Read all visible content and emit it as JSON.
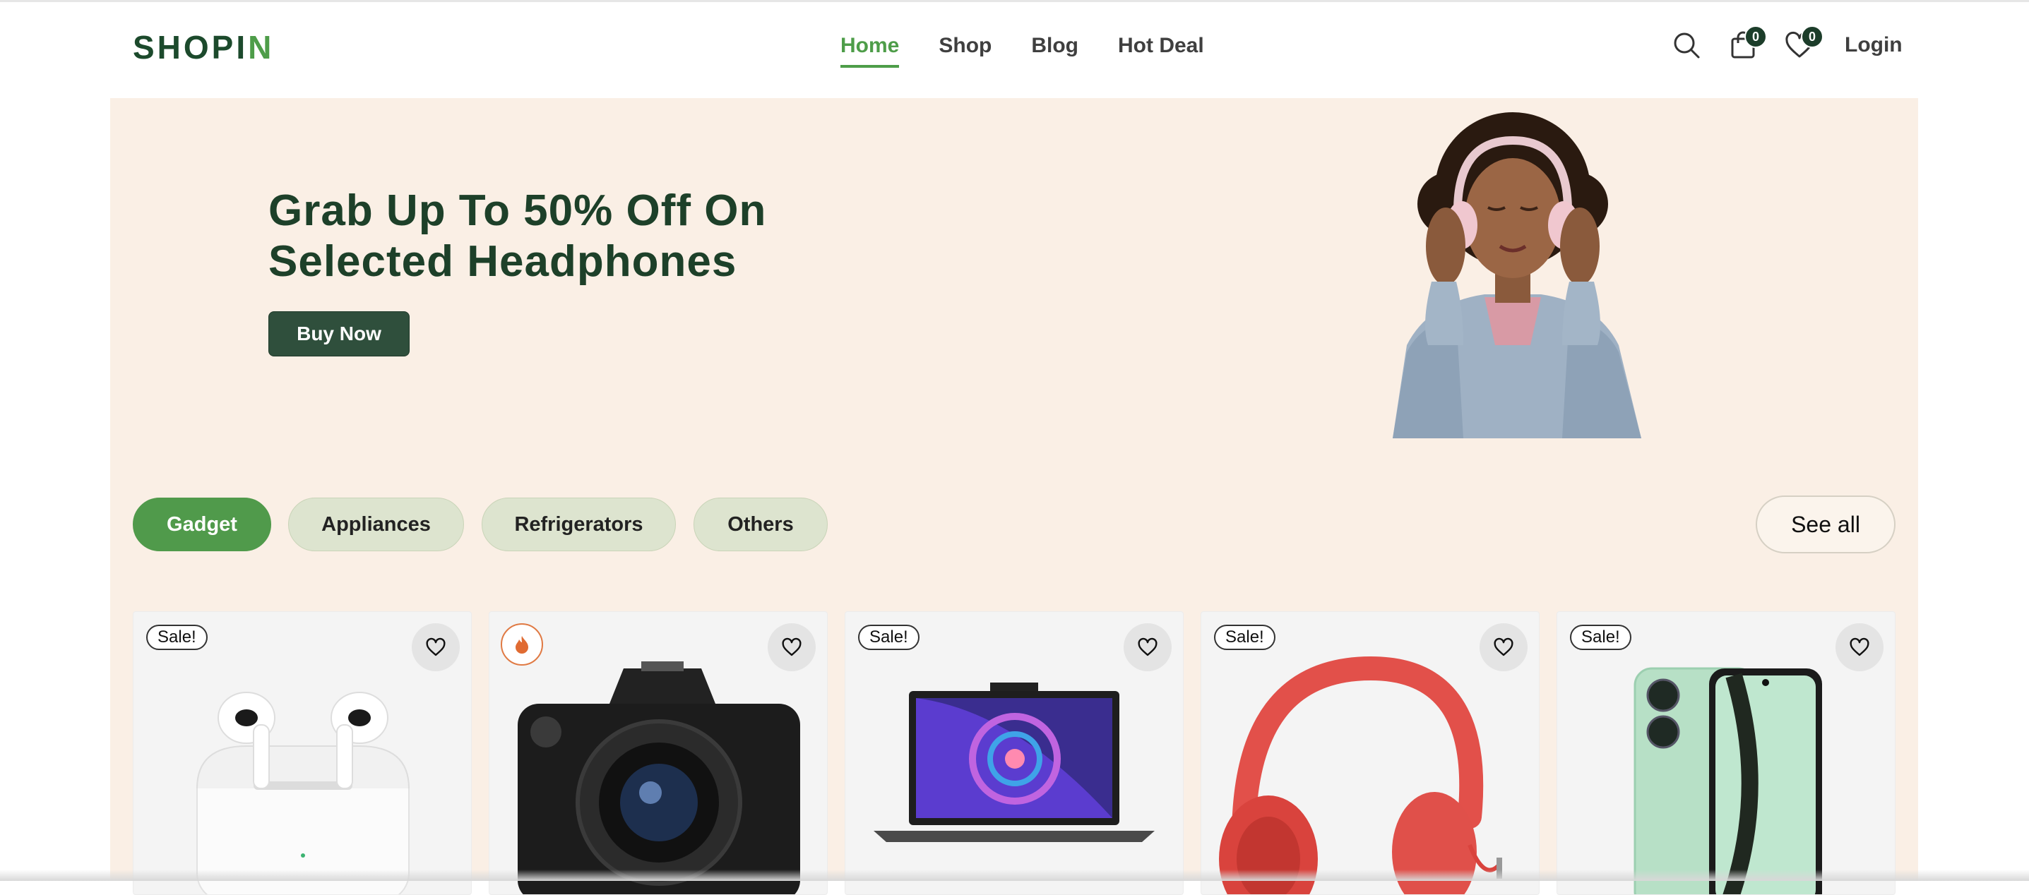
{
  "header": {
    "logo_main": "SHOPI",
    "logo_accent": "N",
    "nav": [
      "Home",
      "Shop",
      "Blog",
      "Hot Deal"
    ],
    "active_nav": "Home",
    "cart_count": "0",
    "wishlist_count": "0",
    "login_label": "Login",
    "icons": [
      "search-icon",
      "cart-icon",
      "heart-icon"
    ]
  },
  "hero": {
    "title_line1": "Grab Up To 50% Off On",
    "title_line2": "Selected Headphones",
    "button_label": "Buy Now"
  },
  "categories": {
    "items": [
      "Gadget",
      "Appliances",
      "Refrigerators",
      "Others"
    ],
    "active": "Gadget",
    "see_all_label": "See all"
  },
  "products": [
    {
      "badge": "Sale!",
      "image": "airpods"
    },
    {
      "badge_icon": "fire-icon",
      "image": "canon-camera"
    },
    {
      "badge": "Sale!",
      "image": "laptop"
    },
    {
      "badge": "Sale!",
      "image": "red-headphones"
    },
    {
      "badge": "Sale!",
      "image": "green-phone"
    }
  ],
  "colors": {
    "brand_dark": "#1c4a2c",
    "brand_green": "#4e9d49",
    "hero_bg": "#faefe5",
    "button_dark": "#2f4f3c",
    "pill_bg": "#dde4cf"
  }
}
